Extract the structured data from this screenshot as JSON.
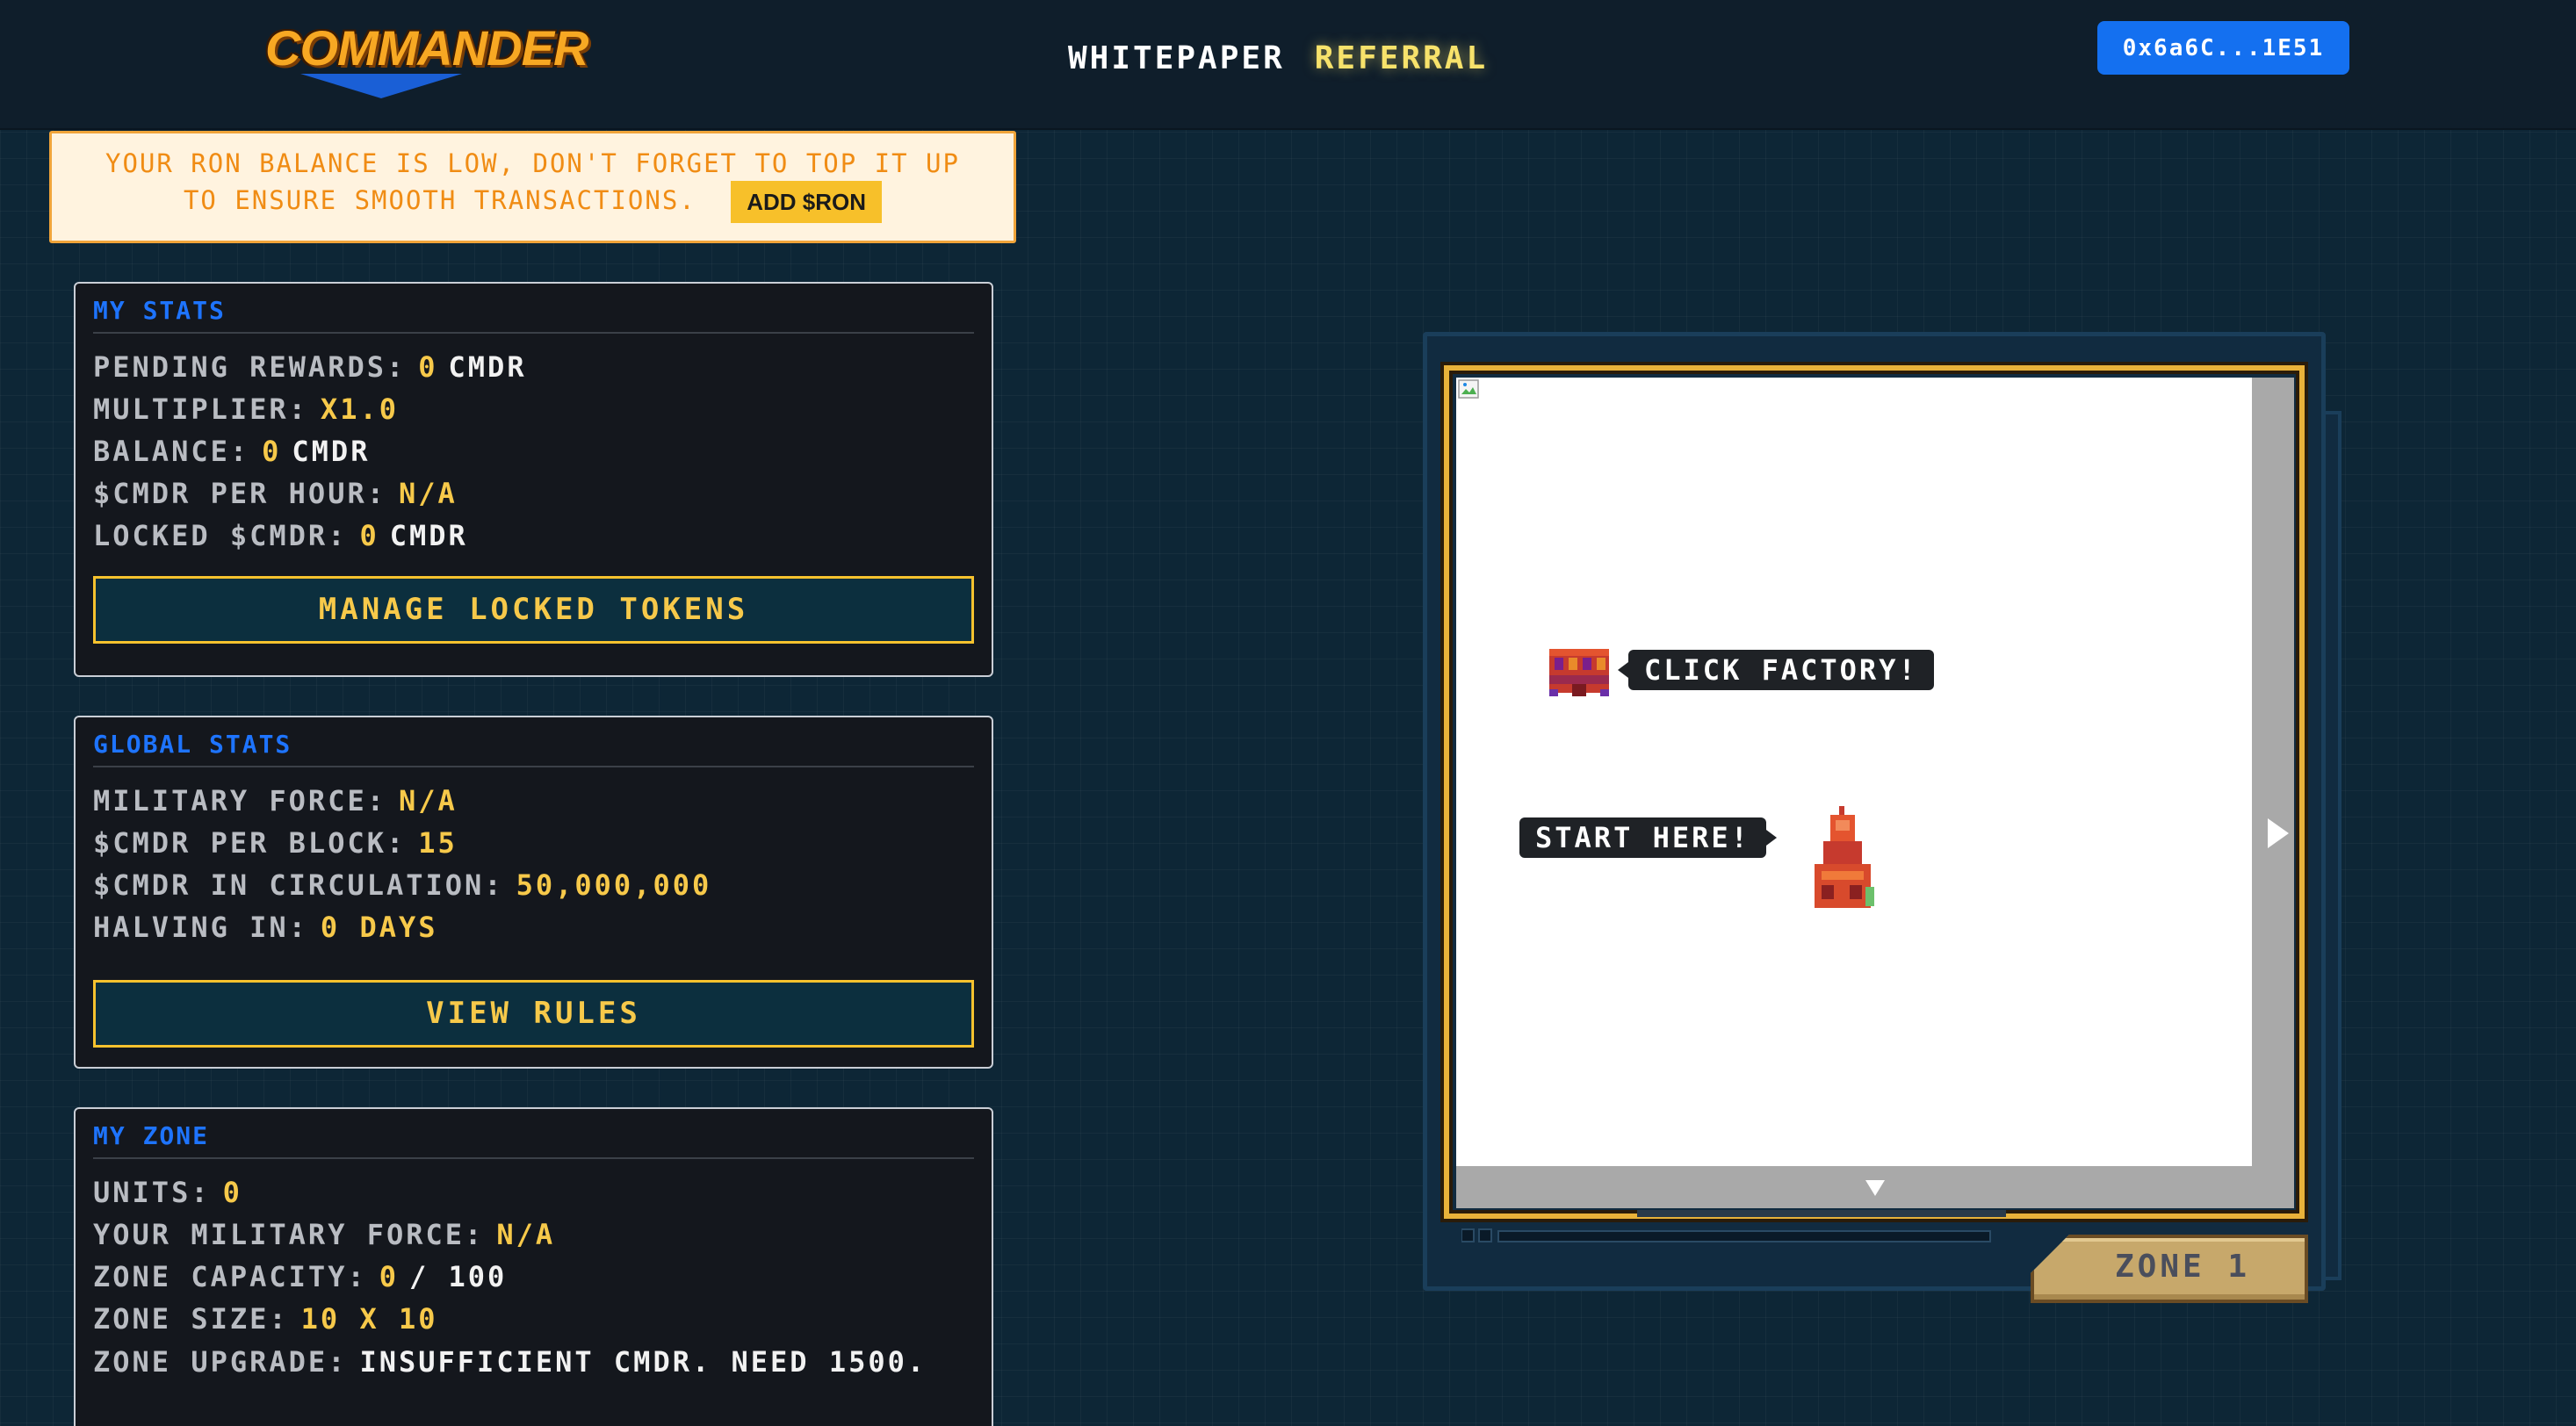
{
  "header": {
    "logo_text": "COMMANDER",
    "nav": [
      {
        "label": "WHITEPAPER",
        "active": false
      },
      {
        "label": "REFERRAL",
        "active": true
      }
    ],
    "wallet": "0x6a6C...1E51"
  },
  "warning": {
    "line1": "YOUR RON BALANCE IS LOW, DON'T FORGET TO TOP IT UP",
    "line2": "TO ENSURE SMOOTH TRANSACTIONS.",
    "button": "ADD $RON"
  },
  "my_stats": {
    "title": "MY STATS",
    "rows": [
      {
        "label": "PENDING REWARDS:",
        "value": "0",
        "unit": "CMDR"
      },
      {
        "label": "MULTIPLIER:",
        "value": "X1.0",
        "unit": ""
      },
      {
        "label": "BALANCE:",
        "value": "0",
        "unit": "CMDR"
      },
      {
        "label": "$CMDR PER HOUR:",
        "value": "N/A",
        "unit": ""
      },
      {
        "label": "LOCKED $CMDR:",
        "value": "0",
        "unit": "CMDR"
      }
    ],
    "button": "MANAGE LOCKED TOKENS"
  },
  "global_stats": {
    "title": "GLOBAL STATS",
    "rows": [
      {
        "label": "MILITARY FORCE:",
        "value": "N/A"
      },
      {
        "label": "$CMDR PER BLOCK:",
        "value": "15"
      },
      {
        "label": "$CMDR IN CIRCULATION:",
        "value": "50,000,000"
      },
      {
        "label": "HALVING IN:",
        "value": "0 DAYS"
      }
    ],
    "button": "VIEW RULES"
  },
  "my_zone": {
    "title": "MY ZONE",
    "rows": [
      {
        "label": "UNITS:",
        "value": "0"
      },
      {
        "label": "YOUR MILITARY FORCE:",
        "value": "N/A"
      },
      {
        "label": "ZONE CAPACITY:",
        "value": "0",
        "suffix": "/ 100"
      },
      {
        "label": "ZONE SIZE:",
        "value": "10 X 10"
      }
    ],
    "upgrade_label": "ZONE UPGRADE:",
    "upgrade_value": "INSUFFICIENT CMDR. NEED 1500."
  },
  "game": {
    "tip_factory": "CLICK FACTORY!",
    "tip_start": "START HERE!",
    "zone_label": "ZONE 1"
  },
  "colors": {
    "background": "#0d2636",
    "accent_blue": "#1470f0",
    "accent_yellow": "#f7c94a",
    "warning_orange": "#f08c14"
  },
  "icons": [
    "broken-image-icon",
    "factory-icon",
    "headquarters-icon",
    "arrow-right-icon",
    "arrow-down-icon"
  ]
}
